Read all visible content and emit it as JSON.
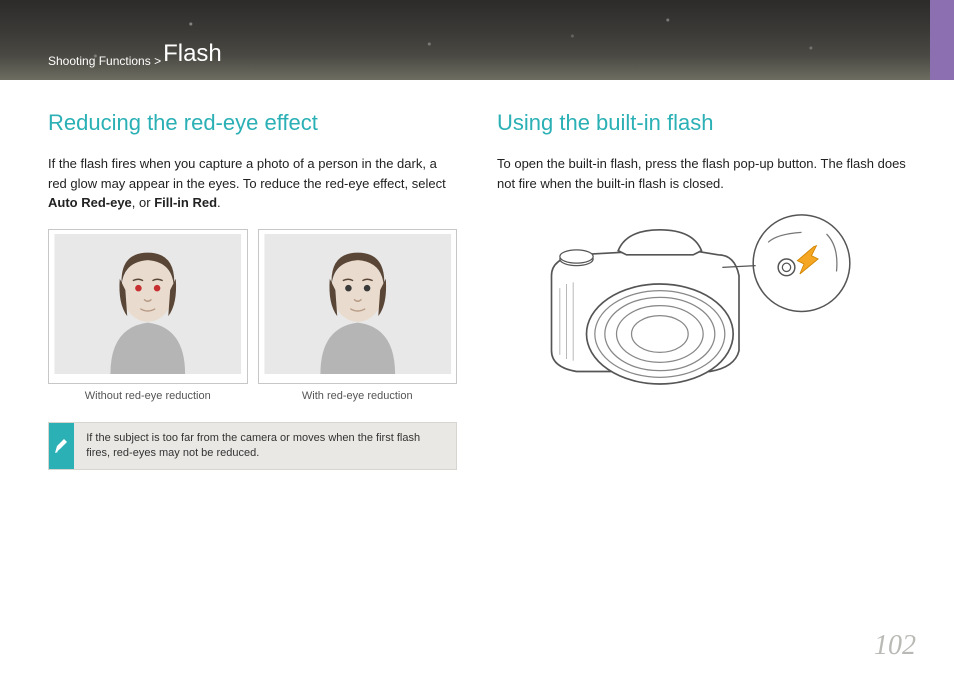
{
  "header": {
    "breadcrumb_prefix": "Shooting Functions > ",
    "title": "Flash"
  },
  "left": {
    "heading": "Reducing the red-eye effect",
    "paragraph_pre": "If the flash fires when you capture a photo of a person in the dark, a red glow may appear in the eyes. To reduce the red-eye effect, select ",
    "bold1": "Auto Red-eye",
    "mid": ", or ",
    "bold2": "Fill-in Red",
    "post": ".",
    "caption_left": "Without red-eye reduction",
    "caption_right": "With red-eye reduction",
    "note": "If the subject is too far from the camera or moves when the first flash fires, red-eyes may not be reduced."
  },
  "right": {
    "heading": "Using the built-in flash",
    "paragraph": "To open the built-in flash, press the flash pop-up button. The flash does not fire when the built-in flash is closed."
  },
  "page_number": "102"
}
